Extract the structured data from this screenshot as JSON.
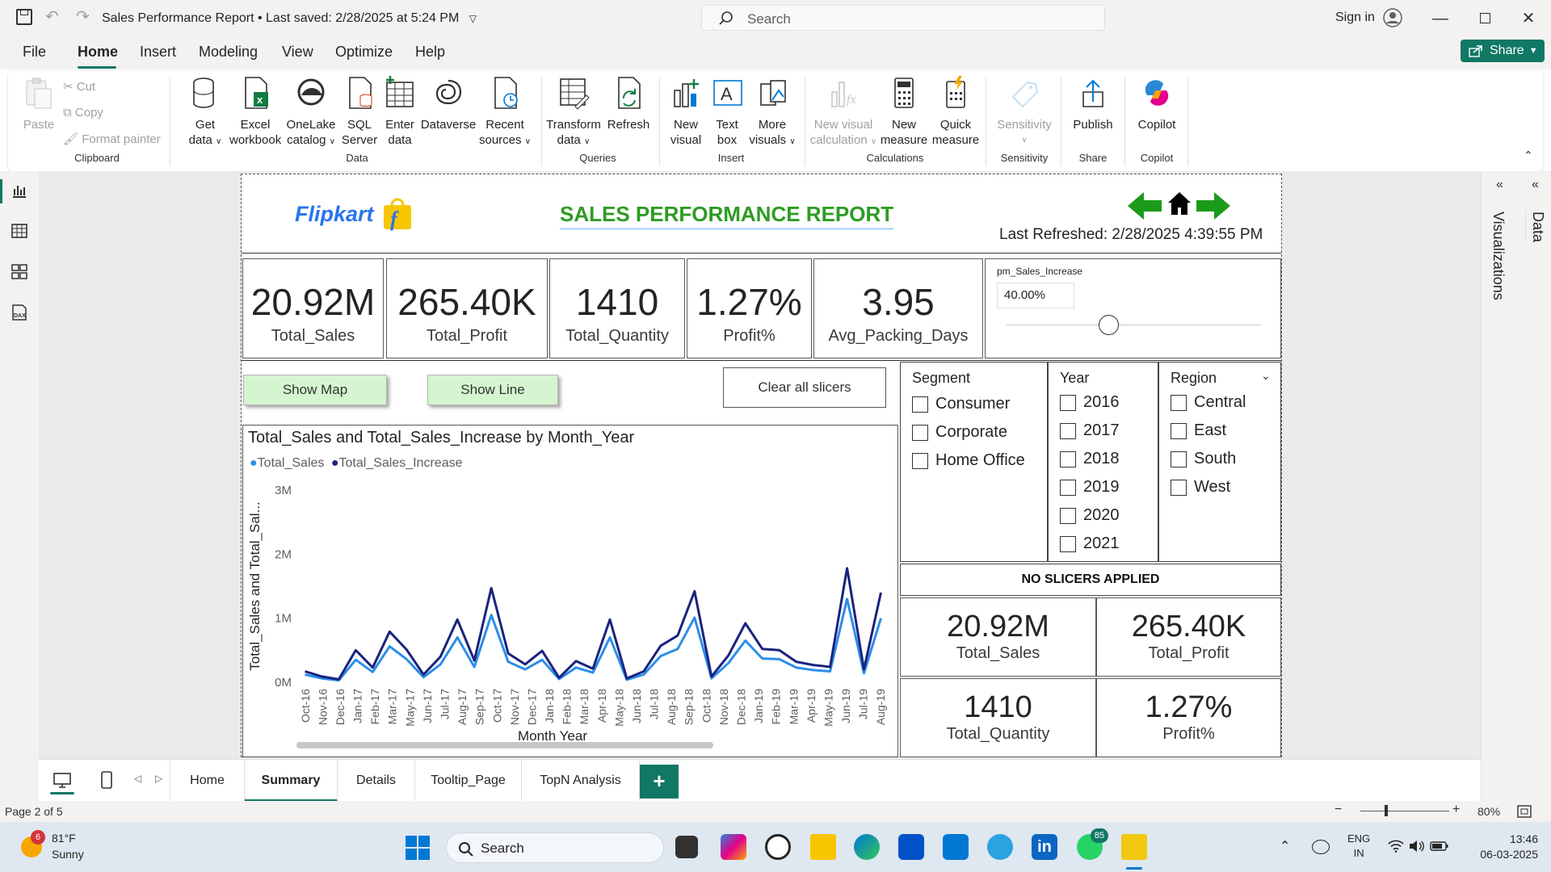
{
  "titlebar": {
    "title": "Sales Performance Report",
    "saved": "Last saved: 2/28/2025 at 5:24 PM",
    "search_placeholder": "Search",
    "sign_in": "Sign in"
  },
  "menu": {
    "items": [
      "File",
      "Home",
      "Insert",
      "Modeling",
      "View",
      "Optimize",
      "Help"
    ],
    "active": "Home",
    "share": "Share"
  },
  "ribbon": {
    "clipboard": {
      "paste": "Paste",
      "cut": "Cut",
      "copy": "Copy",
      "format_painter": "Format painter",
      "group": "Clipboard"
    },
    "data": {
      "get_data": [
        "Get",
        "data"
      ],
      "excel": [
        "Excel",
        "workbook"
      ],
      "onelake": [
        "OneLake",
        "catalog"
      ],
      "sql": [
        "SQL",
        "Server"
      ],
      "enter": [
        "Enter",
        "data"
      ],
      "dataverse": "Dataverse",
      "recent": [
        "Recent",
        "sources"
      ],
      "group": "Data"
    },
    "queries": {
      "transform": [
        "Transform",
        "data"
      ],
      "refresh": "Refresh",
      "group": "Queries"
    },
    "insert": {
      "new_visual": [
        "New",
        "visual"
      ],
      "text_box": [
        "Text",
        "box"
      ],
      "more_visuals": [
        "More",
        "visuals"
      ],
      "group": "Insert"
    },
    "calculations": {
      "new_visual_calc": [
        "New visual",
        "calculation"
      ],
      "new_measure": [
        "New",
        "measure"
      ],
      "quick_measure": [
        "Quick",
        "measure"
      ],
      "group": "Calculations"
    },
    "sensitivity": {
      "label": "Sensitivity",
      "group": "Sensitivity"
    },
    "share": {
      "publish": "Publish",
      "group": "Share"
    },
    "copilot": {
      "label": "Copilot",
      "group": "Copilot"
    }
  },
  "report": {
    "brand": "Flipkart",
    "title": "SALES PERFORMANCE REPORT",
    "last_refreshed": "Last Refreshed: 2/28/2025 4:39:55 PM",
    "kpis": [
      {
        "value": "20.92M",
        "label": "Total_Sales"
      },
      {
        "value": "265.40K",
        "label": "Total_Profit"
      },
      {
        "value": "1410",
        "label": "Total_Quantity"
      },
      {
        "value": "1.27%",
        "label": "Profit%"
      },
      {
        "value": "3.95",
        "label": "Avg_Packing_Days"
      }
    ],
    "param": {
      "name": "pm_Sales_Increase",
      "value": "40.00%",
      "level": 0.4
    },
    "buttons": {
      "show_map": "Show Map",
      "show_line": "Show Line",
      "clear": "Clear all slicers"
    },
    "slicers": {
      "segment": {
        "title": "Segment",
        "items": [
          "Consumer",
          "Corporate",
          "Home Office"
        ]
      },
      "year": {
        "title": "Year",
        "items": [
          "2016",
          "2017",
          "2018",
          "2019",
          "2020",
          "2021"
        ]
      },
      "region": {
        "title": "Region",
        "items": [
          "Central",
          "East",
          "South",
          "West"
        ]
      }
    },
    "no_slicers": "NO SLICERS APPLIED",
    "mini_kpis": [
      {
        "value": "20.92M",
        "label": "Total_Sales"
      },
      {
        "value": "265.40K",
        "label": "Total_Profit"
      },
      {
        "value": "1410",
        "label": "Total_Quantity"
      },
      {
        "value": "1.27%",
        "label": "Profit%"
      }
    ]
  },
  "chart_data": {
    "type": "line",
    "title": "Total_Sales and Total_Sales_Increase by Month_Year",
    "xlabel": "Month  Year",
    "ylabel": "Total_Sales and Total_Sal...",
    "y_ticks": [
      "3M",
      "2M",
      "1M",
      "0M"
    ],
    "ylim": [
      0,
      3000000
    ],
    "legend_position": "top-left",
    "categories": [
      "Oct-16",
      "Nov-16",
      "Dec-16",
      "Jan-17",
      "Feb-17",
      "Mar-17",
      "Apr-17",
      "May-17",
      "Jun-17",
      "Jul-17",
      "Aug-17",
      "Sep-17",
      "Oct-17",
      "Nov-17",
      "Dec-17",
      "Jan-18",
      "Feb-18",
      "Mar-18",
      "Apr-18",
      "May-18",
      "Jun-18",
      "Jul-18",
      "Aug-18",
      "Sep-18",
      "Oct-18",
      "Nov-18",
      "Dec-18",
      "Jan-19",
      "Feb-19",
      "Mar-19",
      "Apr-19",
      "May-19",
      "Jun-19",
      "Jul-19",
      "Aug-19"
    ],
    "x_tick_labels": [
      "Oct-16",
      "Nov-16",
      "Dec-16",
      "Jan-17",
      "Feb-17",
      "Mar-17",
      "May-17",
      "Jun-17",
      "Jul-17",
      "Aug-17",
      "Sep-17",
      "Oct-17",
      "Nov-17",
      "Dec-17",
      "Jan-18",
      "Feb-18",
      "Mar-18",
      "Apr-18",
      "May-18",
      "Jun-18",
      "Jul-18",
      "Aug-18",
      "Sep-18",
      "Oct-18",
      "Nov-18",
      "Dec-18",
      "Jan-19",
      "Feb-19",
      "Mar-19",
      "Apr-19",
      "May-19",
      "Jun-19",
      "Jul-19",
      "Aug-19"
    ],
    "series": [
      {
        "name": "Total_Sales",
        "color": "#2b8ee9",
        "values": [
          120000,
          60000,
          30000,
          350000,
          160000,
          560000,
          360000,
          80000,
          280000,
          700000,
          240000,
          1050000,
          320000,
          200000,
          350000,
          50000,
          230000,
          150000,
          700000,
          40000,
          120000,
          410000,
          520000,
          1010000,
          60000,
          300000,
          650000,
          370000,
          360000,
          230000,
          190000,
          170000,
          1300000,
          140000,
          1000000
        ]
      },
      {
        "name": "Total_Sales_Increase",
        "color": "#1a237e",
        "values": [
          170000,
          90000,
          45000,
          500000,
          230000,
          790000,
          510000,
          120000,
          400000,
          980000,
          340000,
          1470000,
          450000,
          280000,
          490000,
          70000,
          330000,
          210000,
          980000,
          60000,
          170000,
          570000,
          730000,
          1420000,
          90000,
          420000,
          920000,
          520000,
          500000,
          320000,
          270000,
          240000,
          1780000,
          200000,
          1400000
        ]
      }
    ]
  },
  "page_tabs": [
    "Home",
    "Summary",
    "Details",
    "Tooltip_Page",
    "TopN Analysis"
  ],
  "active_tab": "Summary",
  "right_panes": {
    "visualizations": "Visualizations",
    "data": "Data"
  },
  "status": {
    "page": "Page 2 of 5",
    "zoom": "80%"
  },
  "taskbar": {
    "weather_temp": "81°F",
    "weather_desc": "Sunny",
    "weather_badge": "6",
    "search": "Search",
    "whatsapp_badge": "85",
    "lang": "ENG",
    "region": "IN",
    "time": "13:46",
    "date": "06-03-2025"
  }
}
